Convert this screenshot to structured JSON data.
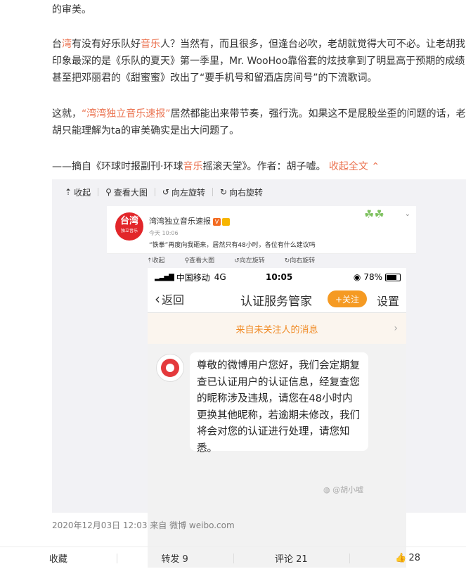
{
  "post": {
    "p0": "的审美。",
    "p1_l1_a": "台",
    "p1_l1_hl1": "湾",
    "p1_l1_b": "有没有好乐队好",
    "p1_l1_hl2": "音乐",
    "p1_l1_c": "人？当然有，而且很多，但逢台必吹，老胡就觉得大可不必。让老胡我",
    "p1_l2": "印象最深的是《乐队的夏天》第一季里，Mr. WooHoo靠俗套的炫技拿到了明显高于预期的成绩，",
    "p1_l3": "甚至把邓丽君的《甜蜜蜜》改出了“要手机号和留酒店房间号”的下流歌词。",
    "p2_l1_a": "这就，",
    "p2_l1_link": "“湾湾独立音乐速报”",
    "p2_l1_b": "居然都能出来带节奏，强行洗。如果这不是屁股坐歪的问题的话，老",
    "p2_l2": "胡只能理解为ta的审美确实是出大问题了。",
    "p3_a": "——摘自《环球时报副刊·环球",
    "p3_hl": "音乐",
    "p3_b": "摇滚天堂》。作者：胡子嘘。",
    "collapse": "收起全文",
    "meta": "2020年12月03日 12:03  来自 微博 weibo.com"
  },
  "media_toolbar": {
    "collapse": "收起",
    "view_large": "查看大图",
    "rotate_left": "向左旋转",
    "rotate_right": "向右旋转"
  },
  "inner_post": {
    "avatar_text": "台湾",
    "avatar_sub": "独立音乐",
    "name": "湾湾独立音乐速报",
    "time": "今天 10:06",
    "text": "“铁拳”再度向我砸来，居然只有48小时，各位有什么建议吗",
    "toolbar_collapse": "收起",
    "toolbar_view": "查看大图",
    "toolbar_left": "向左旋转",
    "toolbar_right": "向右旋转"
  },
  "phone": {
    "carrier": "中国移动",
    "network": "4G",
    "time": "10:05",
    "battery": "78%",
    "battery_level": 0.78,
    "back": "返回",
    "title": "认证服务管家",
    "follow": "+关注",
    "settings": "设置",
    "strangers": "来自未关注人的消息",
    "message": "尊敬的微博用户您好，我们会定期复查已认证用户的认证信息，经复查您的昵称涉及违规，请您在48小时内更换其他昵称，若逾期未修改，我们将会对您的认证进行处理，请您知悉。"
  },
  "watermark": "@胡小嘘",
  "actions": {
    "favorite": "收藏",
    "repost": "转发 9",
    "comment": "评论 21",
    "like": "28"
  },
  "colors": {
    "accent": "#eb7350",
    "follow_button": "#f59a23",
    "avatar_red": "#e2262a"
  }
}
